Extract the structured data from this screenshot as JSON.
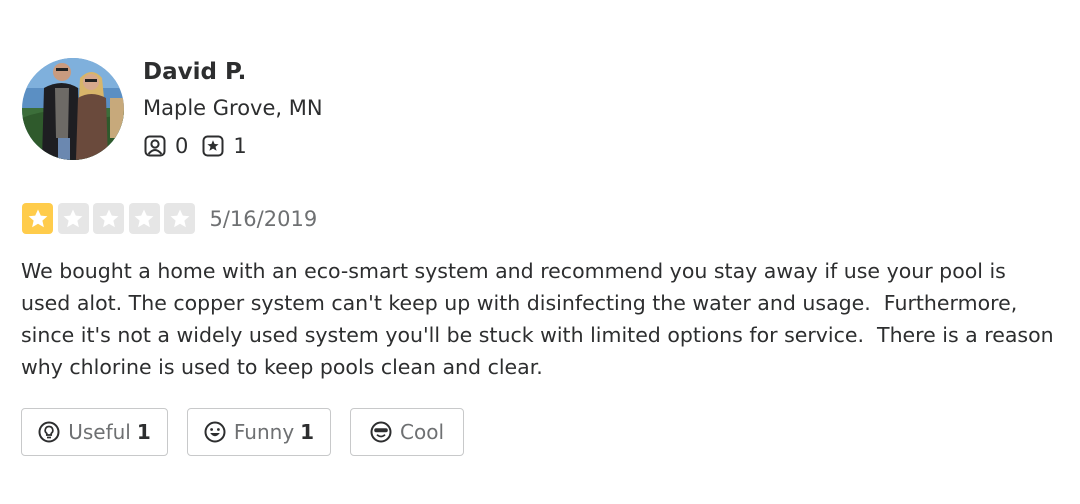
{
  "user": {
    "name": "David P.",
    "location": "Maple Grove, MN",
    "friends_count": "0",
    "reviews_count": "1",
    "avatar_icon": "user-photo"
  },
  "review": {
    "rating": 1,
    "rating_max": 5,
    "star_color_active": "#ffcc4b",
    "star_color_inactive": "#e6e6e6",
    "date": "5/16/2019",
    "lines": [
      "We bought a home with an eco-smart system and recommend you stay away if use your pool is",
      "used alot. The copper system can't keep up with disinfecting the water and usage.  Furthermore,",
      "since it's not a widely used system you'll be stuck with limited options for service.  There is a reason",
      "why chlorine is used to keep pools clean and clear."
    ]
  },
  "actions": {
    "useful": {
      "label": "Useful",
      "count": "1",
      "icon": "bulb-icon"
    },
    "funny": {
      "label": "Funny",
      "count": "1",
      "icon": "smile-icon"
    },
    "cool": {
      "label": "Cool",
      "icon": "sunglasses-icon"
    }
  }
}
